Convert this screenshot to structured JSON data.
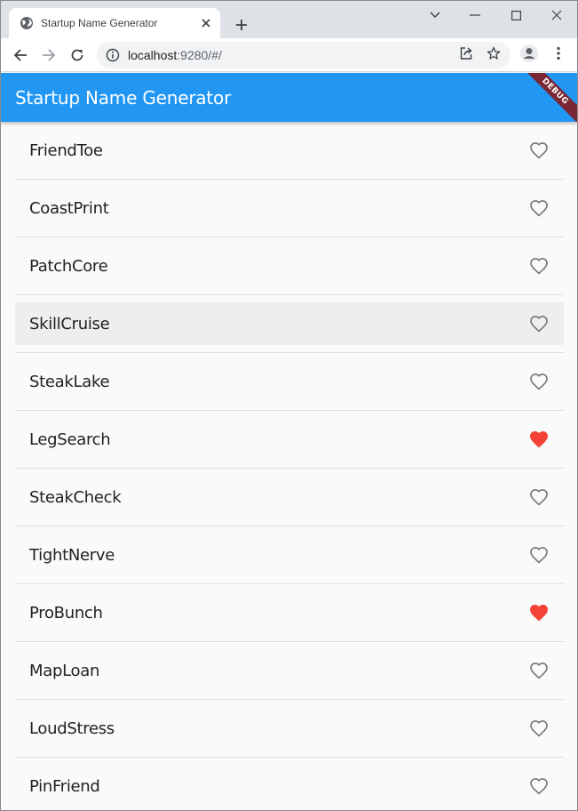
{
  "browser": {
    "tab_title": "Startup Name Generator",
    "url_host": "localhost",
    "url_rest": ":9280/#/"
  },
  "app": {
    "title": "Startup Name Generator",
    "debug_label": "DEBUG",
    "accent_color": "#2196f3",
    "favorite_color": "#f44336"
  },
  "names": [
    {
      "label": "FriendToe",
      "favorite": false
    },
    {
      "label": "CoastPrint",
      "favorite": false
    },
    {
      "label": "PatchCore",
      "favorite": false
    },
    {
      "label": "SkillCruise",
      "favorite": false
    },
    {
      "label": "SteakLake",
      "favorite": false
    },
    {
      "label": "LegSearch",
      "favorite": true
    },
    {
      "label": "SteakCheck",
      "favorite": false
    },
    {
      "label": "TightNerve",
      "favorite": false
    },
    {
      "label": "ProBunch",
      "favorite": true
    },
    {
      "label": "MapLoan",
      "favorite": false
    },
    {
      "label": "LoudStress",
      "favorite": false
    },
    {
      "label": "PinFriend",
      "favorite": false
    }
  ]
}
